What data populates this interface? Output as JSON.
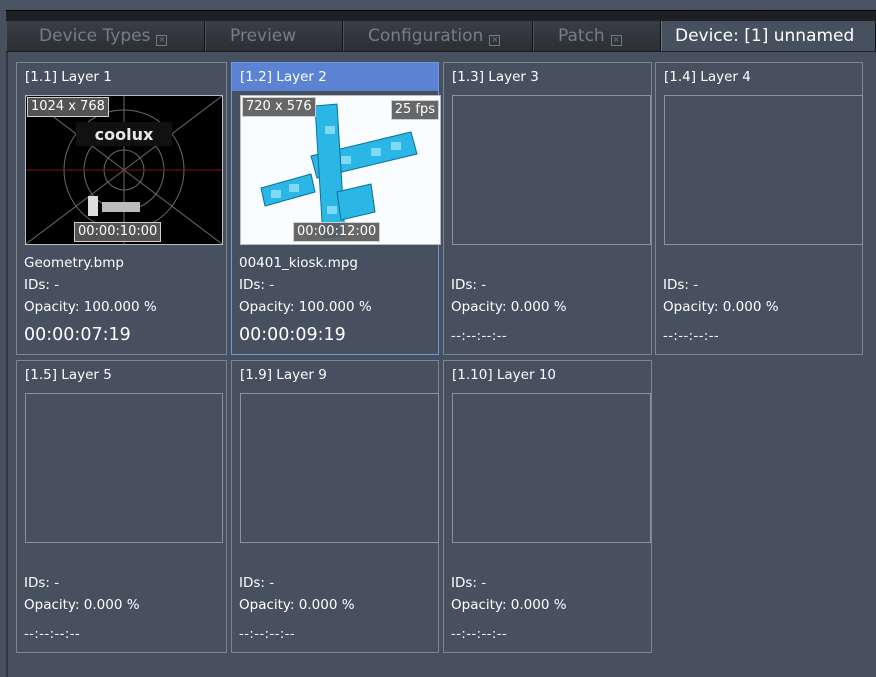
{
  "tabs": [
    {
      "label": "Device Types",
      "closable": true,
      "active": false
    },
    {
      "label": "Preview",
      "closable": false,
      "active": false
    },
    {
      "label": "Configuration",
      "closable": true,
      "active": false
    },
    {
      "label": "Patch",
      "closable": true,
      "active": false
    },
    {
      "label": "Device: [1] unnamed",
      "closable": false,
      "active": true
    }
  ],
  "close_glyph": "⊠",
  "layers": [
    {
      "title": "[1.1] Layer 1",
      "resolution": "1024 x 768",
      "fps": "",
      "duration": "00:00:10:00",
      "file": "Geometry.bmp",
      "ids": "IDs: -",
      "opacity": "Opacity: 100.000 %",
      "time": "00:00:07:19",
      "selected": false,
      "thumb": "geometry-test-pattern",
      "thumb_logo": "coolux"
    },
    {
      "title": "[1.2] Layer 2",
      "resolution": "720 x 576",
      "fps": "25 fps",
      "duration": "00:00:12:00",
      "file": "00401_kiosk.mpg",
      "ids": "IDs: -",
      "opacity": "Opacity: 100.000 %",
      "time": "00:00:09:19",
      "selected": true,
      "thumb": "kiosk-video-frame"
    },
    {
      "title": "[1.3] Layer 3",
      "ids": "IDs: -",
      "opacity": "Opacity: 0.000 %",
      "time": "--:--:--:--",
      "selected": false
    },
    {
      "title": "[1.4] Layer 4",
      "ids": "IDs: -",
      "opacity": "Opacity: 0.000 %",
      "time": "--:--:--:--",
      "selected": false
    },
    {
      "title": "[1.5] Layer 5",
      "ids": "IDs: -",
      "opacity": "Opacity: 0.000 %",
      "time": "--:--:--:--",
      "selected": false
    },
    {
      "title": "[1.9] Layer 9",
      "ids": "IDs: -",
      "opacity": "Opacity: 0.000 %",
      "time": "--:--:--:--",
      "selected": false
    },
    {
      "title": "[1.10] Layer 10",
      "ids": "IDs: -",
      "opacity": "Opacity: 0.000 %",
      "time": "--:--:--:--",
      "selected": false
    }
  ],
  "colors": {
    "background": "#46505f",
    "selection": "#5b82d3",
    "tabbar": "#1d1f22"
  }
}
